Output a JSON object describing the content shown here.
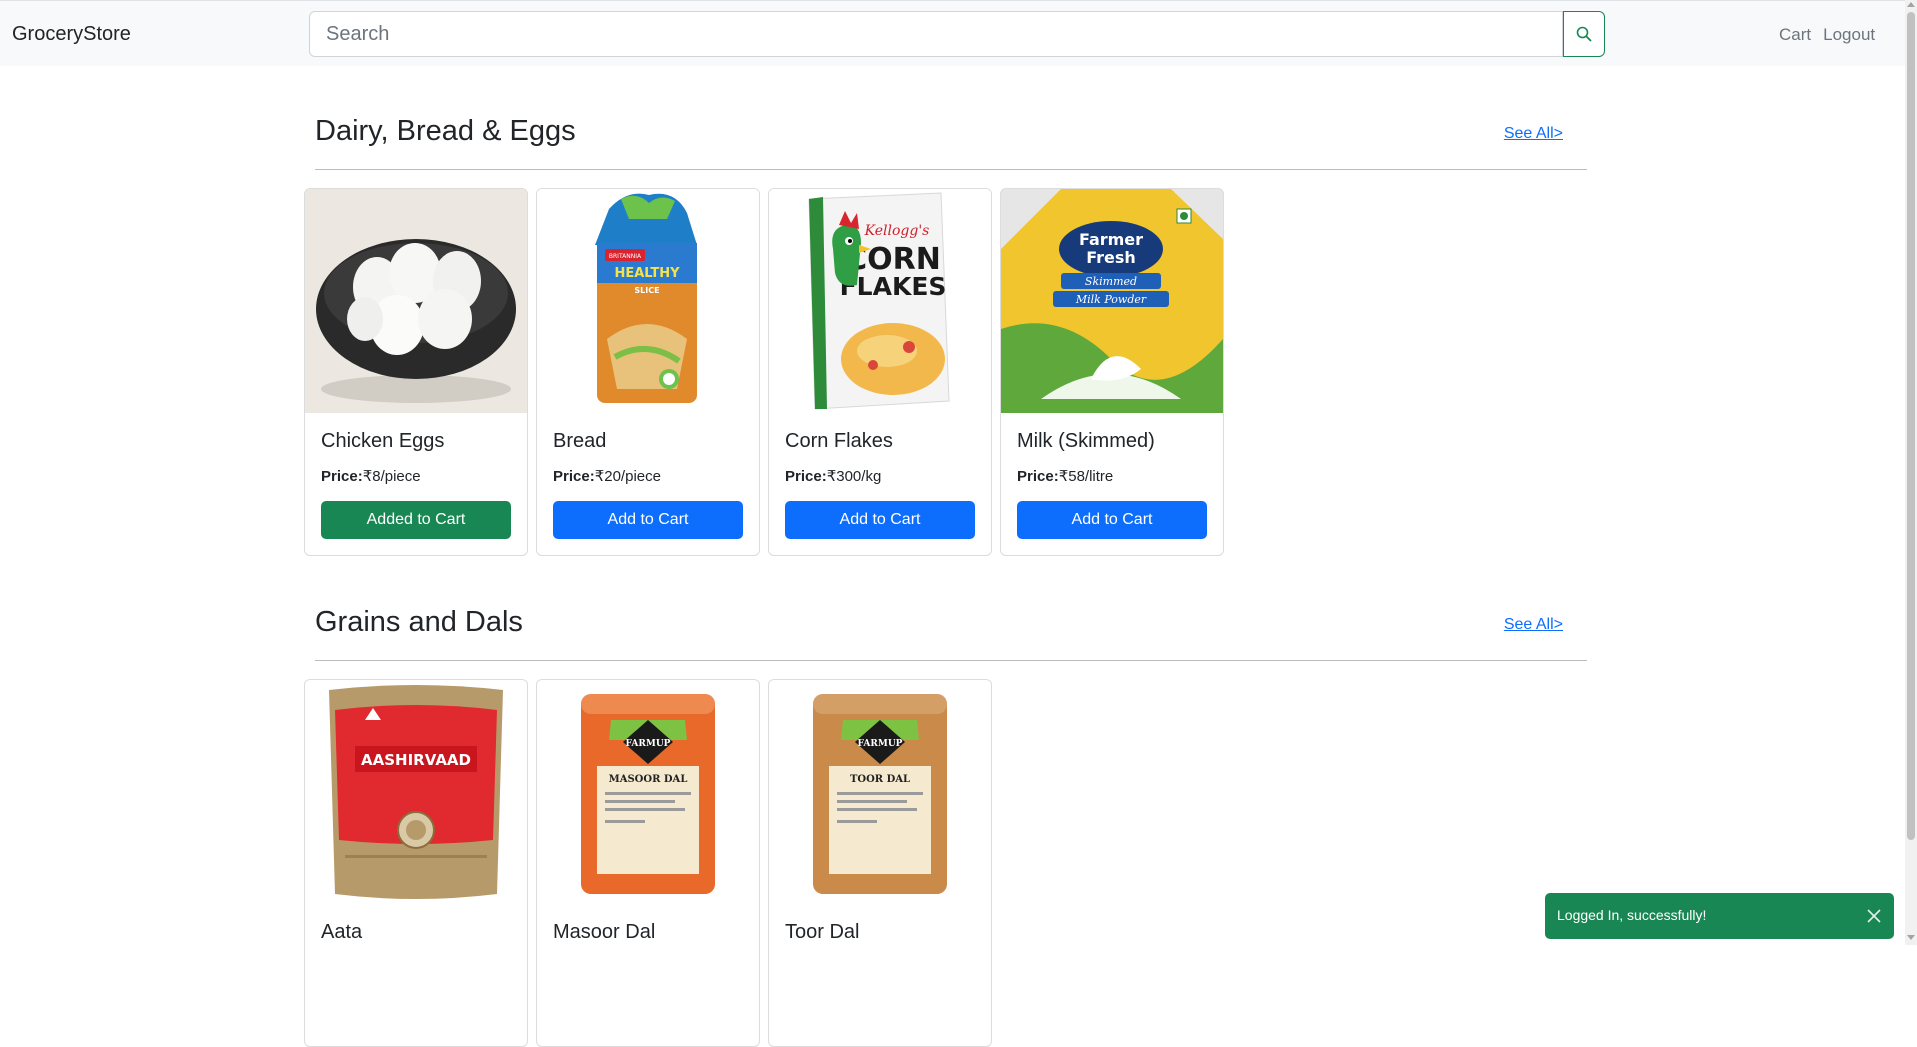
{
  "navbar": {
    "brand": "GroceryStore",
    "search": {
      "placeholder": "Search",
      "value": ""
    },
    "links": [
      "Cart",
      "Logout"
    ]
  },
  "sections": [
    {
      "title": "Dairy, Bread & Eggs",
      "see_all": "See All>",
      "products": [
        {
          "name": "Chicken Eggs",
          "price_label": "Price:",
          "price": "₹8/piece",
          "button": "Added to Cart",
          "button_state": "added",
          "icon": "eggs-bowl-image"
        },
        {
          "name": "Bread",
          "price_label": "Price:",
          "price": "₹20/piece",
          "button": "Add to Cart",
          "button_state": "default",
          "icon": "bread-loaf-image"
        },
        {
          "name": "Corn Flakes",
          "price_label": "Price:",
          "price": "₹300/kg",
          "button": "Add to Cart",
          "button_state": "default",
          "icon": "corn-flakes-box-image"
        },
        {
          "name": "Milk (Skimmed)",
          "price_label": "Price:",
          "price": "₹58/litre",
          "button": "Add to Cart",
          "button_state": "default",
          "icon": "milk-powder-pack-image"
        }
      ]
    },
    {
      "title": "Grains and Dals",
      "see_all": "See All>",
      "products": [
        {
          "name": "Aata",
          "icon": "atta-bag-image"
        },
        {
          "name": "Masoor Dal",
          "icon": "masoor-dal-pack-image"
        },
        {
          "name": "Toor Dal",
          "icon": "toor-dal-pack-image"
        }
      ]
    }
  ],
  "image_text": {
    "bread_brand": "BRITANNIA",
    "bread_line": "HEALTHY",
    "bread_sub": "SLICE",
    "cornflakes_brand": "Kellogg's",
    "cornflakes_name_1": "CORN",
    "cornflakes_name_2": "FLAKES",
    "milk_brand_1": "Farmer",
    "milk_brand_2": "Fresh",
    "milk_name_1": "Skimmed",
    "milk_name_2": "Milk Powder",
    "atta_brand": "AASHIRVAAD",
    "farmup_brand": "FARMUP",
    "masoor_name": "MASOOR DAL",
    "toor_name": "TOOR DAL"
  },
  "toast": {
    "message": "Logged In, successfully!"
  },
  "colors": {
    "primary": "#0d6efd",
    "success": "#198754",
    "navbar_bg": "#f8f9fa",
    "link": "#0d6efd"
  }
}
